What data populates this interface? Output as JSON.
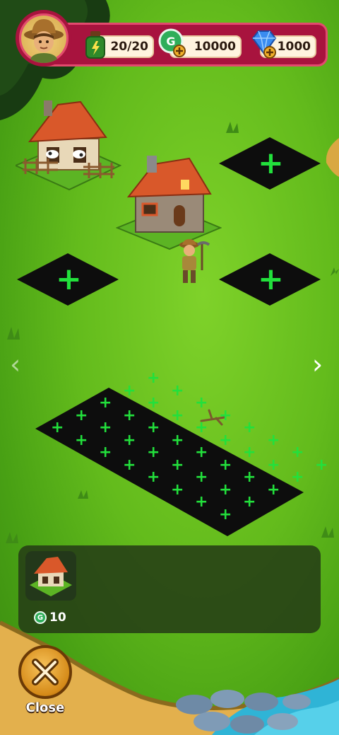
{
  "hud": {
    "energy": "20/20",
    "gold": "10000",
    "gems": "1000"
  },
  "build_panel": {
    "item_cost": "10",
    "coin_symbol": "G"
  },
  "navigation": {
    "prev_glyph": "‹",
    "next_glyph": "›"
  },
  "close_button": {
    "label": "Close"
  },
  "plot_symbol": "+",
  "colors": {
    "hud_bar": "#a8133e",
    "plus": "#22e03c",
    "grass": "#63bb1c"
  }
}
